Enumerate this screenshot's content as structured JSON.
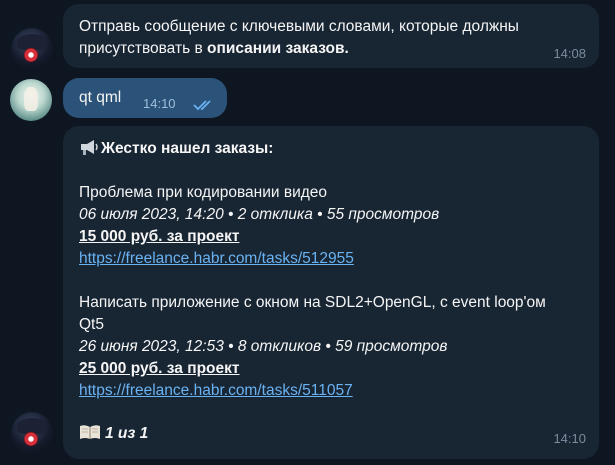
{
  "messages": [
    {
      "time": "14:08",
      "text_plain": "Отправь сообщение с ключевыми словами, которые должны присутствовать в ",
      "text_bold": "описании заказов."
    },
    {
      "time": "14:10",
      "text": "qt qml"
    },
    {
      "time": "14:10",
      "header_icon": "megaphone-icon",
      "header": "Жестко нашел заказы:",
      "orders": [
        {
          "title_lines": [
            "Проблема при кодировании видео"
          ],
          "meta": "06 июля 2023, 14:20 • 2 отклика • 55 просмотров",
          "price": "15 000 руб. за проект",
          "link": "https://freelance.habr.com/tasks/512955"
        },
        {
          "title_lines": [
            "Написать приложение с окном на SDL2+OpenGL, с event loop'ом",
            "Qt5"
          ],
          "meta": "26 июня 2023, 12:53 • 8 откликов • 59 просмотров",
          "price": "25 000 руб. за проект",
          "link": "https://freelance.habr.com/tasks/511057"
        }
      ],
      "footer_icon": "book-icon",
      "footer": "1 из 1"
    }
  ],
  "colors": {
    "background": "#0e1621",
    "incoming_bubble": "#182533",
    "outgoing_bubble": "#2b5278",
    "link": "#6ab3f3"
  }
}
